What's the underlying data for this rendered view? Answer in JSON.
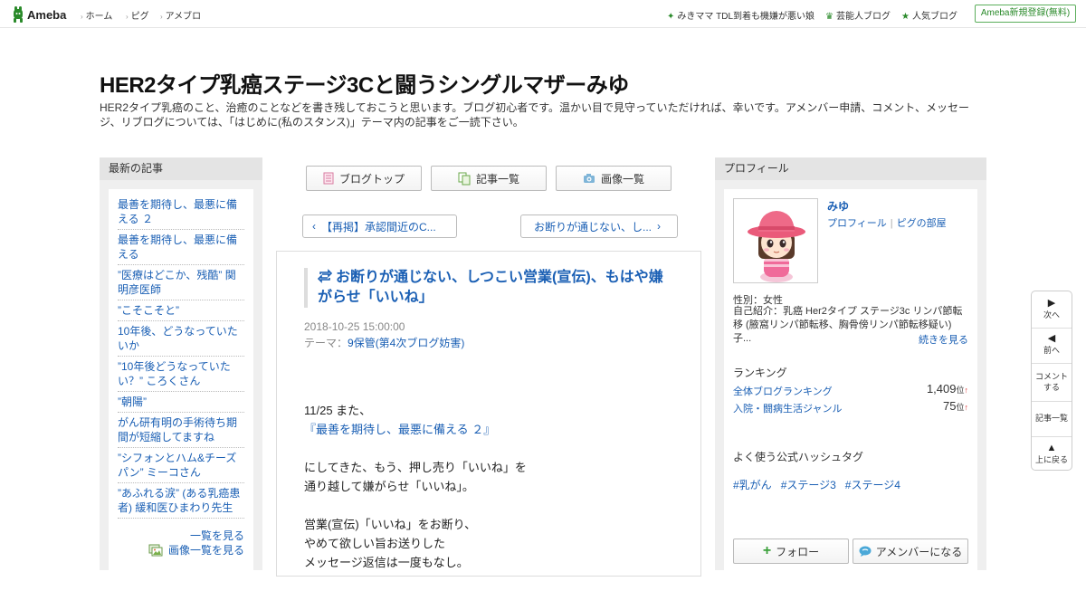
{
  "topbar": {
    "logo": "Ameba",
    "nav": [
      "ホーム",
      "ピグ",
      "アメブロ"
    ],
    "trends": [
      {
        "icon": "sparkle-icon",
        "label": "みきママ TDL到着も機嫌が悪い娘"
      },
      {
        "icon": "crown-icon",
        "label": "芸能人ブログ"
      },
      {
        "icon": "star-icon",
        "label": "人気ブログ"
      }
    ],
    "signup": "Ameba新規登録(無料)"
  },
  "blog": {
    "title": "HER2タイプ乳癌ステージ3Cと闘うシングルマザーみゆ",
    "description": "HER2タイプ乳癌のこと、治癒のことなどを書き残しておこうと思います。ブログ初心者です。温かい目で見守っていただければ、幸いです。アメンバー申請、コメント、メッセージ、リブログについては、「はじめに(私のスタンス)」テーマ内の記事をご一読下さい。"
  },
  "left": {
    "heading": "最新の記事",
    "items": [
      "最善を期待し、最悪に備える ２",
      "最善を期待し、最悪に備える",
      "”医療はどこか、残酷” 関明彦医師",
      "”こそこそと”",
      "10年後、どうなっていたいか",
      "”10年後どうなっていたい？” ころくさん",
      "”朝陽”",
      "がん研有明の手術待ち期間が短縮してますね",
      "”シフォンとハム&チーズパン” ミーコさん",
      "”あふれる涙” (ある乳癌患者) 緩和医ひまわり先生"
    ],
    "see_all": "一覧を見る",
    "see_images": "画像一覧を見る"
  },
  "tabs": [
    {
      "icon": "document-icon",
      "label": "ブログトップ"
    },
    {
      "icon": "copy-icon",
      "label": "記事一覧"
    },
    {
      "icon": "camera-icon",
      "label": "画像一覧"
    }
  ],
  "pager": {
    "prev": "【再掲】承認間近のC...",
    "next": "お断りが通じない、し..."
  },
  "entry": {
    "title": "お断りが通じない、しつこい営業(宣伝)、もはや嫌がらせ「いいね」",
    "date": "2018-10-25 15:00:00",
    "theme_label": "テーマ：",
    "theme": "9保管(第4次ブログ妨害)",
    "p1_line1": "11/25 また、",
    "p1_link": "『最善を期待し、最悪に備える ２』",
    "p2_line1": "にしてきた、もう、押し売り「いいね」を",
    "p2_line2": "通り越して嫌がらせ「いいね」。",
    "p3_line1": "営業(宣伝)「いいね」をお断り、",
    "p3_line2": "やめて欲しい旨お送りした",
    "p3_line3": "メッセージ返信は一度もなし。"
  },
  "profile": {
    "heading": "プロフィール",
    "name": "みゆ",
    "link_profile": "プロフィール",
    "link_room": "ピグの部屋",
    "gender": "性別：女性",
    "intro": "自己紹介：乳癌 Her2タイプ ステージ3c リンパ節転移 (腋窩リンパ節転移、胸骨傍リンパ節転移疑い) 子...",
    "more": "続きを見る",
    "ranking_heading": "ランキング",
    "rankings": [
      {
        "label": "全体ブログランキング",
        "value": "1,409",
        "unit": "位",
        "arrow": "↑"
      },
      {
        "label": "入院・闘病生活ジャンル",
        "value": "75",
        "unit": "位",
        "arrow": "↑"
      }
    ],
    "hashtag_heading": "よく使う公式ハッシュタグ",
    "hashtags": [
      "#乳がん",
      "#ステージ3",
      "#ステージ4"
    ],
    "follow": "フォロー",
    "amember": "アメンバーになる"
  },
  "floatnav": {
    "next": "次へ",
    "prev": "前へ",
    "comment": "コメントする",
    "list": "記事一覧",
    "top": "上に戻る"
  },
  "colors": {
    "link": "#1a5fb4",
    "accent_green": "#2a8a2a",
    "sidebar_bg": "#efefef"
  }
}
